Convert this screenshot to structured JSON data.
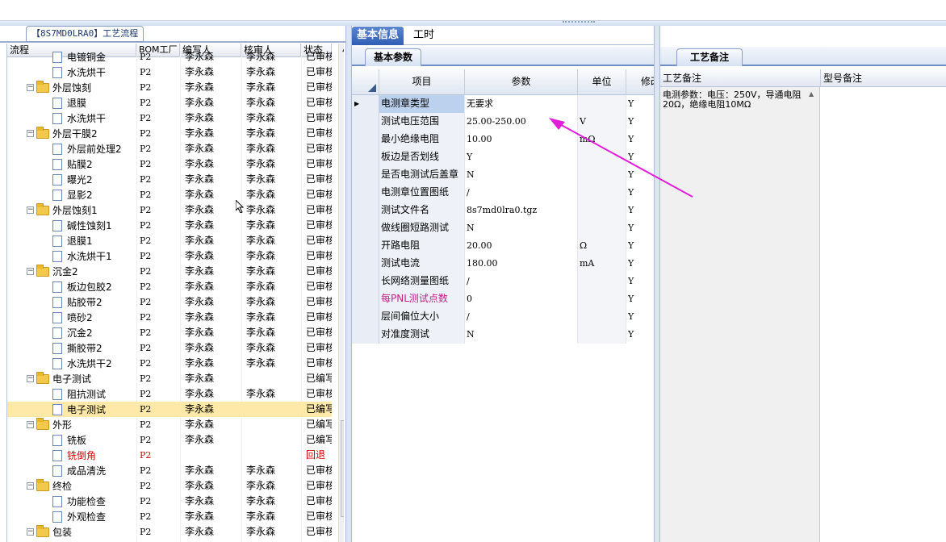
{
  "left_panel": {
    "tab_title": "【8S7MD0LRA0】工艺流程",
    "columns": [
      "流程",
      "BOM工厂",
      "编写人",
      "核审人",
      "状态"
    ],
    "rows": [
      {
        "level": 2,
        "type": "doc",
        "name": "电镀铜金",
        "bom": "P2",
        "writer": "李永森",
        "reviewer": "李永森",
        "status": "已审核"
      },
      {
        "level": 2,
        "type": "doc",
        "name": "水洗烘干",
        "bom": "P2",
        "writer": "李永森",
        "reviewer": "李永森",
        "status": "已审核"
      },
      {
        "level": 1,
        "type": "folder",
        "name": "外层蚀刻",
        "bom": "P2",
        "writer": "李永森",
        "reviewer": "李永森",
        "status": "已审核"
      },
      {
        "level": 2,
        "type": "doc",
        "name": "退膜",
        "bom": "P2",
        "writer": "李永森",
        "reviewer": "李永森",
        "status": "已审核"
      },
      {
        "level": 2,
        "type": "doc",
        "name": "水洗烘干",
        "bom": "P2",
        "writer": "李永森",
        "reviewer": "李永森",
        "status": "已审核"
      },
      {
        "level": 1,
        "type": "folder",
        "name": "外层干膜2",
        "bom": "P2",
        "writer": "李永森",
        "reviewer": "李永森",
        "status": "已审核"
      },
      {
        "level": 2,
        "type": "doc",
        "name": "外层前处理2",
        "bom": "P2",
        "writer": "李永森",
        "reviewer": "李永森",
        "status": "已审核"
      },
      {
        "level": 2,
        "type": "doc",
        "name": "贴膜2",
        "bom": "P2",
        "writer": "李永森",
        "reviewer": "李永森",
        "status": "已审核"
      },
      {
        "level": 2,
        "type": "doc",
        "name": "曝光2",
        "bom": "P2",
        "writer": "李永森",
        "reviewer": "李永森",
        "status": "已审核"
      },
      {
        "level": 2,
        "type": "doc",
        "name": "显影2",
        "bom": "P2",
        "writer": "李永森",
        "reviewer": "李永森",
        "status": "已审核"
      },
      {
        "level": 1,
        "type": "folder",
        "name": "外层蚀刻1",
        "bom": "P2",
        "writer": "李永森",
        "reviewer": "李永森",
        "status": "已审核"
      },
      {
        "level": 2,
        "type": "doc",
        "name": "碱性蚀刻1",
        "bom": "P2",
        "writer": "李永森",
        "reviewer": "李永森",
        "status": "已审核"
      },
      {
        "level": 2,
        "type": "doc",
        "name": "退膜1",
        "bom": "P2",
        "writer": "李永森",
        "reviewer": "李永森",
        "status": "已审核"
      },
      {
        "level": 2,
        "type": "doc",
        "name": "水洗烘干1",
        "bom": "P2",
        "writer": "李永森",
        "reviewer": "李永森",
        "status": "已审核"
      },
      {
        "level": 1,
        "type": "folder",
        "name": "沉金2",
        "bom": "P2",
        "writer": "李永森",
        "reviewer": "李永森",
        "status": "已审核"
      },
      {
        "level": 2,
        "type": "doc",
        "name": "板边包胶2",
        "bom": "P2",
        "writer": "李永森",
        "reviewer": "李永森",
        "status": "已审核"
      },
      {
        "level": 2,
        "type": "doc",
        "name": "贴胶带2",
        "bom": "P2",
        "writer": "李永森",
        "reviewer": "李永森",
        "status": "已审核"
      },
      {
        "level": 2,
        "type": "doc",
        "name": "喷砂2",
        "bom": "P2",
        "writer": "李永森",
        "reviewer": "李永森",
        "status": "已审核"
      },
      {
        "level": 2,
        "type": "doc",
        "name": "沉金2",
        "bom": "P2",
        "writer": "李永森",
        "reviewer": "李永森",
        "status": "已审核"
      },
      {
        "level": 2,
        "type": "doc",
        "name": "撕胶带2",
        "bom": "P2",
        "writer": "李永森",
        "reviewer": "李永森",
        "status": "已审核"
      },
      {
        "level": 2,
        "type": "doc",
        "name": "水洗烘干2",
        "bom": "P2",
        "writer": "李永森",
        "reviewer": "李永森",
        "status": "已审核"
      },
      {
        "level": 1,
        "type": "folder",
        "name": "电子测试",
        "bom": "P2",
        "writer": "李永森",
        "reviewer": "",
        "status": "已编写"
      },
      {
        "level": 2,
        "type": "doc",
        "name": "阻抗测试",
        "bom": "P2",
        "writer": "李永森",
        "reviewer": "李永森",
        "status": "已审核"
      },
      {
        "level": 2,
        "type": "doc",
        "name": "电子测试",
        "bom": "P2",
        "writer": "李永森",
        "reviewer": "",
        "status": "已编写",
        "selected": true
      },
      {
        "level": 1,
        "type": "folder",
        "name": "外形",
        "bom": "P2",
        "writer": "李永森",
        "reviewer": "",
        "status": "已编写"
      },
      {
        "level": 2,
        "type": "doc",
        "name": "铣板",
        "bom": "P2",
        "writer": "李永森",
        "reviewer": "",
        "status": "已编写"
      },
      {
        "level": 2,
        "type": "doc",
        "name": "铣倒角",
        "bom": "P2",
        "writer": "",
        "reviewer": "",
        "status": "回退",
        "red": true
      },
      {
        "level": 2,
        "type": "doc",
        "name": "成品清洗",
        "bom": "P2",
        "writer": "李永森",
        "reviewer": "李永森",
        "status": "已审核"
      },
      {
        "level": 1,
        "type": "folder",
        "name": "终检",
        "bom": "P2",
        "writer": "李永森",
        "reviewer": "李永森",
        "status": "已审核"
      },
      {
        "level": 2,
        "type": "doc",
        "name": "功能检查",
        "bom": "P2",
        "writer": "李永森",
        "reviewer": "李永森",
        "status": "已审核"
      },
      {
        "level": 2,
        "type": "doc",
        "name": "外观检查",
        "bom": "P2",
        "writer": "李永森",
        "reviewer": "李永森",
        "status": "已审核"
      },
      {
        "level": 1,
        "type": "folder",
        "name": "包装",
        "bom": "P2",
        "writer": "李永森",
        "reviewer": "李永森",
        "status": "已审核"
      }
    ]
  },
  "middle_panel": {
    "tabs": [
      "基本信息",
      "工时"
    ],
    "subtab": "基本参数",
    "columns": [
      "项目",
      "参数",
      "单位",
      "修改"
    ],
    "rows": [
      {
        "item": "电测章类型",
        "param": "无要求",
        "unit": "",
        "mod": "Y"
      },
      {
        "item": "测试电压范围",
        "param": "25.00-250.00",
        "unit": "V",
        "mod": "Y"
      },
      {
        "item": "最小绝缘电阻",
        "param": "10.00",
        "unit": "mΩ",
        "mod": "Y"
      },
      {
        "item": "板边是否划线",
        "param": "Y",
        "unit": "",
        "mod": "Y"
      },
      {
        "item": "是否电测试后盖章",
        "param": "N",
        "unit": "",
        "mod": "Y"
      },
      {
        "item": "电测章位置图纸",
        "param": "/",
        "unit": "",
        "mod": "Y"
      },
      {
        "item": "测试文件名",
        "param": "8s7md0lra0.tgz",
        "unit": "",
        "mod": "Y"
      },
      {
        "item": "做线圈短路测试",
        "param": "N",
        "unit": "",
        "mod": "Y"
      },
      {
        "item": "开路电阻",
        "param": "20.00",
        "unit": "Ω",
        "mod": "Y"
      },
      {
        "item": "测试电流",
        "param": "180.00",
        "unit": "mA",
        "mod": "Y"
      },
      {
        "item": "长网络测量图纸",
        "param": "/",
        "unit": "",
        "mod": "Y"
      },
      {
        "item": "每PNL测试点数",
        "param": "0",
        "unit": "",
        "mod": "Y",
        "pink": true
      },
      {
        "item": "层间偏位大小",
        "param": "/",
        "unit": "",
        "mod": "Y"
      },
      {
        "item": "对准度测试",
        "param": "N",
        "unit": "",
        "mod": "Y"
      }
    ]
  },
  "right_panel": {
    "subtab": "工艺备注",
    "col_notes": "工艺备注",
    "col_model": "型号备注",
    "notes_text": "电测参数：电压：250V，导通电阻20Ω，绝缘电阻10MΩ"
  },
  "colors": {
    "accent": "#2f5eb3",
    "annotation_arrow": "#e020d8",
    "selected_row": "#ffe9a8"
  }
}
